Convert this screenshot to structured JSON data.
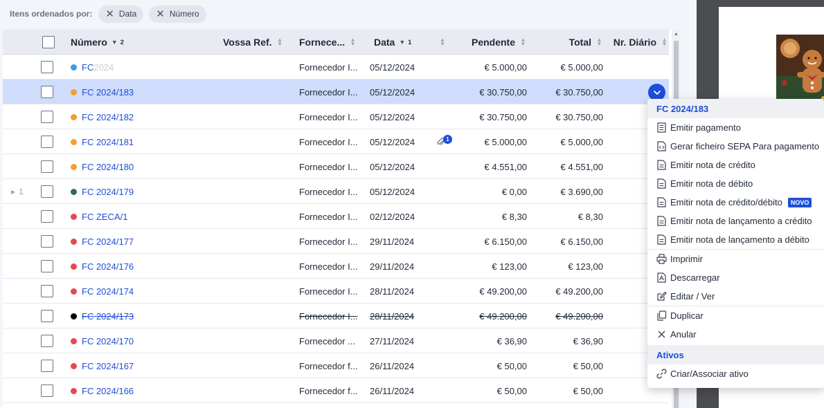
{
  "sortbar": {
    "label": "Itens ordenados por:",
    "chips": [
      "Data",
      "Número"
    ]
  },
  "table": {
    "headers": {
      "numero": "Número",
      "numero_sort_rank": "2",
      "vossa_ref": "Vossa Ref.",
      "fornecedor": "Fornece...",
      "data": "Data",
      "data_sort_rank": "1",
      "pendente": "Pendente",
      "total": "Total",
      "nr_diario": "Nr. Diário"
    },
    "rows": [
      {
        "status_color": "#3b9be6",
        "numero": "FC",
        "numero_faded": "2024",
        "fornecedor": "Fornecedor I...",
        "data": "05/12/2024",
        "pendente": "€ 5.000,00",
        "total": "€ 5.000,00"
      },
      {
        "status_color": "#f59e2a",
        "numero": "FC 2024/183",
        "fornecedor": "Fornecedor I...",
        "data": "05/12/2024",
        "pendente": "€ 30.750,00",
        "total": "€ 30.750,00"
      },
      {
        "status_color": "#f59e2a",
        "numero": "FC 2024/182",
        "fornecedor": "Fornecedor I...",
        "data": "05/12/2024",
        "pendente": "€ 30.750,00",
        "total": "€ 30.750,00"
      },
      {
        "status_color": "#f59e2a",
        "numero": "FC 2024/181",
        "fornecedor": "Fornecedor I...",
        "data": "05/12/2024",
        "attachments": "1",
        "pendente": "€ 5.000,00",
        "total": "€ 5.000,00"
      },
      {
        "status_color": "#f59e2a",
        "numero": "FC 2024/180",
        "fornecedor": "Fornecedor I...",
        "data": "05/12/2024",
        "pendente": "€ 4.551,00",
        "total": "€ 4.551,00"
      },
      {
        "status_color": "#2f6b4f",
        "numero": "FC 2024/179",
        "expander": "1",
        "fornecedor": "Fornecedor I...",
        "data": "05/12/2024",
        "pendente": "€ 0,00",
        "total": "€ 3.690,00"
      },
      {
        "status_color": "#e5484d",
        "numero": "FC ZECA/1",
        "fornecedor": "Fornecedor I...",
        "data": "02/12/2024",
        "pendente": "€ 8,30",
        "total": "€ 8,30"
      },
      {
        "status_color": "#e5484d",
        "numero": "FC 2024/177",
        "fornecedor": "Fornecedor I...",
        "data": "29/11/2024",
        "pendente": "€ 6.150,00",
        "total": "€ 6.150,00"
      },
      {
        "status_color": "#e5484d",
        "numero": "FC 2024/176",
        "fornecedor": "Fornecedor I...",
        "data": "29/11/2024",
        "pendente": "€ 123,00",
        "total": "€ 123,00"
      },
      {
        "status_color": "#e5484d",
        "numero": "FC 2024/174",
        "fornecedor": "Fornecedor I...",
        "data": "28/11/2024",
        "pendente": "€ 49.200,00",
        "total": "€ 49.200,00"
      },
      {
        "status_color": "#000000",
        "numero": "FC 2024/173",
        "fornecedor": "Fornecedor I...",
        "data": "28/11/2024",
        "pendente": "€ 49.200,00",
        "total": "€ 49.200,00",
        "cancelled": true
      },
      {
        "status_color": "#e5484d",
        "numero": "FC 2024/170",
        "fornecedor": "Fornecedor ...",
        "data": "27/11/2024",
        "pendente": "€ 36,90",
        "total": "€ 36,90"
      },
      {
        "status_color": "#e5484d",
        "numero": "FC 2024/167",
        "fornecedor": "Fornecedor f...",
        "data": "26/11/2024",
        "pendente": "€ 50,00",
        "total": "€ 50,00"
      },
      {
        "status_color": "#e5484d",
        "numero": "FC 2024/166",
        "fornecedor": "Fornecedor f...",
        "data": "26/11/2024",
        "pendente": "€ 50,00",
        "total": "€ 50,00"
      }
    ]
  },
  "menu": {
    "title": "FC 2024/183",
    "group1": [
      {
        "label": "Emitir pagamento",
        "icon": "receipt-icon"
      },
      {
        "label": "Gerar ficheiro SEPA Para pagamento",
        "icon": "code-file-icon"
      },
      {
        "label": "Emitir nota de crédito",
        "icon": "document-icon"
      },
      {
        "label": "Emitir nota de débito",
        "icon": "document-icon"
      },
      {
        "label": "Emitir nota de crédito/débito",
        "icon": "document-icon",
        "badge": "NOVO"
      },
      {
        "label": "Emitir nota de lançamento a crédito",
        "icon": "document-icon"
      },
      {
        "label": "Emitir nota de lançamento a débito",
        "icon": "document-icon"
      }
    ],
    "group2": [
      {
        "label": "Imprimir",
        "icon": "printer-icon"
      },
      {
        "label": "Descarregar",
        "icon": "pdf-icon"
      },
      {
        "label": "Editar / Ver",
        "icon": "edit-icon"
      }
    ],
    "group3": [
      {
        "label": "Duplicar",
        "icon": "copy-icon"
      },
      {
        "label": "Anular",
        "icon": "close-icon"
      }
    ],
    "section_ativos": "Ativos",
    "group4": [
      {
        "label": "Criar/Associar ativo",
        "icon": "link-icon"
      }
    ]
  },
  "colors": {
    "accent": "#1d4ed8",
    "selected_row": "#cfdcfc",
    "header_bg": "#e8ebf2"
  }
}
